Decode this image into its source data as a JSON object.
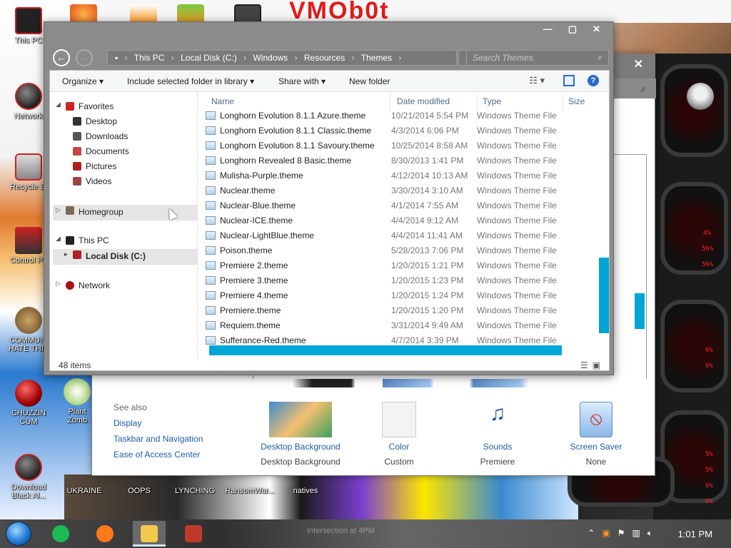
{
  "desktop": {
    "brand_text": "VMOb0t",
    "icons_left": [
      {
        "label": "This PC"
      },
      {
        "label": "Network"
      },
      {
        "label": "Recycle Bi"
      },
      {
        "label": "Control Pa"
      },
      {
        "label": "COMMUNI HATE THIS"
      },
      {
        "label": "CHUZZIN CUM"
      },
      {
        "label": "Download Black Al..."
      }
    ],
    "icons_bottom": [
      {
        "label": "Plant Zomb"
      },
      {
        "label": "UKRAINE"
      },
      {
        "label": "OOPS"
      },
      {
        "label": "LYNCHING"
      },
      {
        "label": "RansomWar..."
      },
      {
        "label": "natives"
      }
    ],
    "hud_readouts": [
      "4%",
      "56%",
      "56%",
      "6%",
      "6%",
      "5%",
      "5%",
      "6%",
      "6%"
    ]
  },
  "personalization": {
    "see_also_header": "See also",
    "see_also_links": [
      "Display",
      "Taskbar and Navigation",
      "Ease of Access Center"
    ],
    "items": [
      {
        "name": "Desktop Background",
        "sub": "Desktop Background",
        "icon": "desktop-background-icon"
      },
      {
        "name": "Color",
        "sub": "Custom",
        "icon": "color-swatch-icon"
      },
      {
        "name": "Sounds",
        "sub": "Premiere",
        "icon": "sounds-icon"
      },
      {
        "name": "Screen Saver",
        "sub": "None",
        "icon": "screen-saver-icon"
      }
    ]
  },
  "explorer": {
    "address": [
      "This PC",
      "Local Disk (C:)",
      "Windows",
      "Resources",
      "Themes"
    ],
    "search_placeholder": "Search Themes",
    "toolbar": {
      "organize": "Organize",
      "include": "Include selected folder in library",
      "share": "Share with",
      "new_folder": "New folder"
    },
    "nav": {
      "favorites": "Favorites",
      "desktop": "Desktop",
      "downloads": "Downloads",
      "documents": "Documents",
      "pictures": "Pictures",
      "videos": "Videos",
      "homegroup": "Homegroup",
      "this_pc": "This PC",
      "local_disk": "Local Disk (C:)",
      "network": "Network"
    },
    "columns": {
      "name": "Name",
      "date": "Date modified",
      "type": "Type",
      "size": "Size"
    },
    "files": [
      {
        "name": "Longhorn Evolution 8.1.1 Azure.theme",
        "date": "10/21/2014 5:54 PM",
        "type": "Windows Theme File"
      },
      {
        "name": "Longhorn Evolution 8.1.1 Classic.theme",
        "date": "4/3/2014 6:06 PM",
        "type": "Windows Theme File"
      },
      {
        "name": "Longhorn Evolution 8.1.1 Savoury.theme",
        "date": "10/25/2014 8:58 AM",
        "type": "Windows Theme File"
      },
      {
        "name": "Longhorn Revealed 8 Basic.theme",
        "date": "8/30/2013 1:41 PM",
        "type": "Windows Theme File"
      },
      {
        "name": "Mulisha-Purple.theme",
        "date": "4/12/2014 10:13 AM",
        "type": "Windows Theme File"
      },
      {
        "name": "Nuclear.theme",
        "date": "3/30/2014 3:10 AM",
        "type": "Windows Theme File"
      },
      {
        "name": "Nuclear-Blue.theme",
        "date": "4/1/2014 7:55 AM",
        "type": "Windows Theme File"
      },
      {
        "name": "Nuclear-ICE.theme",
        "date": "4/4/2014 9:12 AM",
        "type": "Windows Theme File"
      },
      {
        "name": "Nuclear-LightBlue.theme",
        "date": "4/4/2014 11:41 AM",
        "type": "Windows Theme File"
      },
      {
        "name": "Poison.theme",
        "date": "5/28/2013 7:06 PM",
        "type": "Windows Theme File"
      },
      {
        "name": "Premiere 2.theme",
        "date": "1/20/2015 1:21 PM",
        "type": "Windows Theme File"
      },
      {
        "name": "Premiere 3.theme",
        "date": "1/20/2015 1:23 PM",
        "type": "Windows Theme File"
      },
      {
        "name": "Premiere 4.theme",
        "date": "1/20/2015 1:24 PM",
        "type": "Windows Theme File"
      },
      {
        "name": "Premiere.theme",
        "date": "1/20/2015 1:20 PM",
        "type": "Windows Theme File"
      },
      {
        "name": "Requiem.theme",
        "date": "3/31/2014 9:49 AM",
        "type": "Windows Theme File"
      },
      {
        "name": "Sufferance-Red.theme",
        "date": "4/7/2014 3:39 PM",
        "type": "Windows Theme File"
      }
    ],
    "status_count": "48 items"
  },
  "taskbar": {
    "clock": "1:01 PM",
    "bg_text": "Intersection at 4PM",
    "apps": [
      {
        "name": "spotify",
        "color": "#1db954"
      },
      {
        "name": "firefox",
        "color": "#ff7a1a"
      },
      {
        "name": "file-explorer",
        "color": "#f2c94c"
      },
      {
        "name": "game",
        "color": "#c0392b"
      }
    ]
  }
}
